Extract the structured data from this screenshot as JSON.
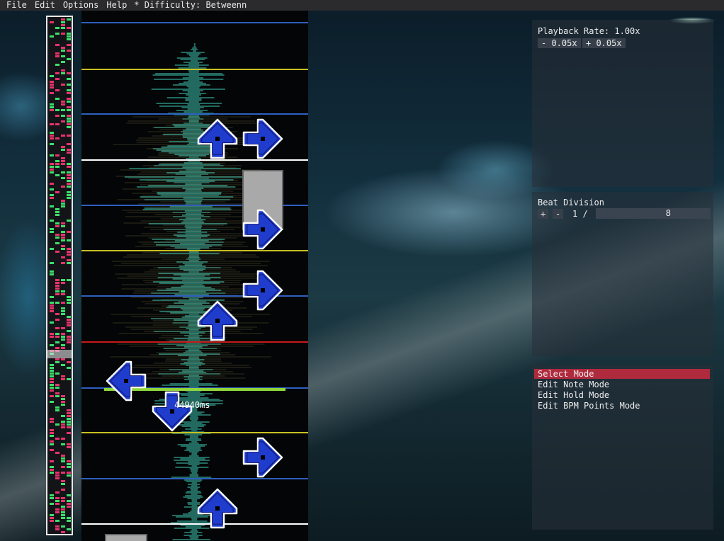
{
  "menu": {
    "items": [
      "File",
      "Edit",
      "Options",
      "Help"
    ],
    "difficulty_label": "* Difficulty: Betweenn"
  },
  "playback": {
    "rate_label": "Playback Rate: 1.00x",
    "decrease_label": "- 0.05x",
    "increase_label": "+ 0.05x"
  },
  "beat_division": {
    "title": "Beat Division",
    "plus_label": "+",
    "minus_label": "-",
    "prefix": "1 /",
    "value": "8"
  },
  "modes": {
    "items": [
      "Select Mode",
      "Edit Note Mode",
      "Edit Hold Mode",
      "Edit BPM Points Mode"
    ],
    "selected": "Select Mode"
  },
  "chart": {
    "time_label": "44940ms",
    "colors": {
      "beat_white": "#ffffff",
      "beat_blue": "#2f5fbf",
      "beat_yellow": "#c8c022",
      "beat_red": "#c81a1a",
      "playhead": "#8fd63a",
      "waveform": "#3fc5b0",
      "arrow_fill": "#1f3ccc",
      "arrow_stroke": "#ffffff",
      "hold_body": "#a9a9a9"
    },
    "notes": [
      {
        "lane": "up",
        "type": "tap"
      },
      {
        "lane": "right",
        "type": "tap"
      },
      {
        "lane": "right",
        "type": "hold"
      },
      {
        "lane": "right",
        "type": "tap"
      },
      {
        "lane": "up",
        "type": "tap"
      },
      {
        "lane": "left",
        "type": "tap"
      },
      {
        "lane": "down",
        "type": "tap"
      },
      {
        "lane": "right",
        "type": "tap"
      },
      {
        "lane": "up",
        "type": "tap"
      }
    ]
  }
}
